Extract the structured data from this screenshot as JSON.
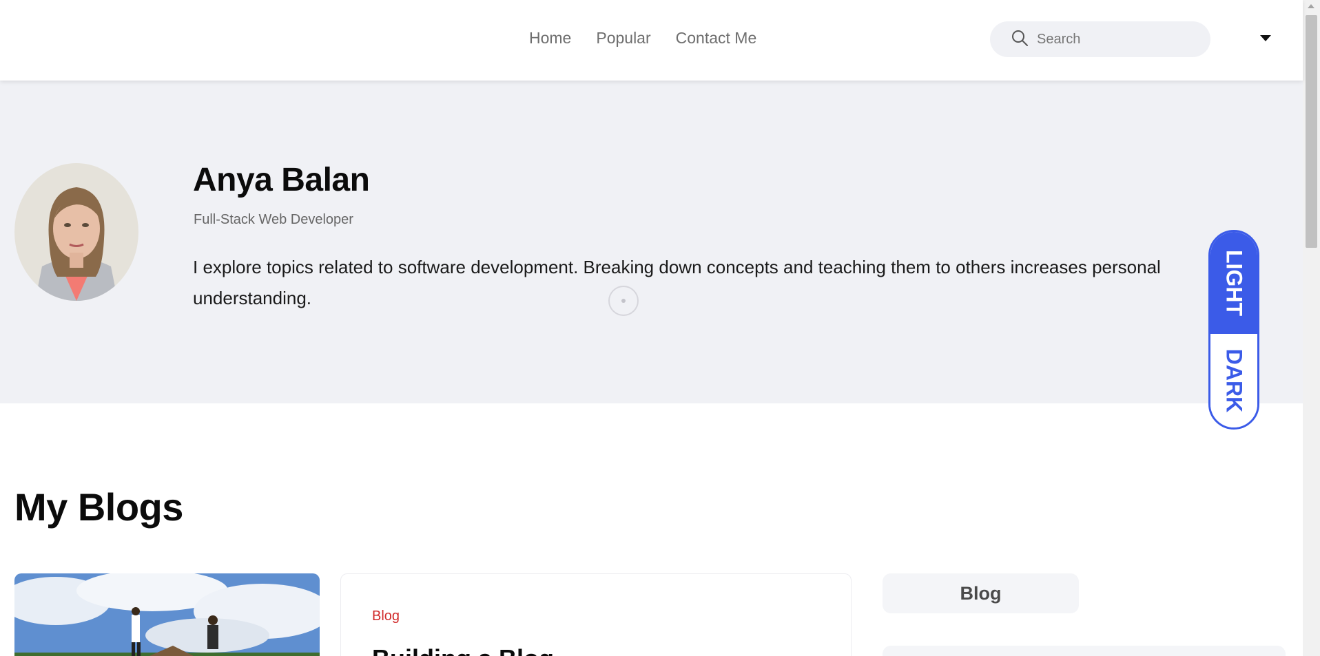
{
  "header": {
    "nav": [
      {
        "label": "Home"
      },
      {
        "label": "Popular"
      },
      {
        "label": "Contact Me"
      }
    ],
    "search": {
      "placeholder": "Search",
      "value": ""
    }
  },
  "profile": {
    "name": "Anya Balan",
    "role": "Full-Stack Web Developer",
    "bio": "I explore topics related to software development. Breaking down concepts and teaching them to others increases personal understanding."
  },
  "theme_toggle": {
    "light_label": "LIGHT",
    "dark_label": "DARK",
    "active": "light",
    "accent_color": "#3b5be8"
  },
  "blogs": {
    "section_title": "My Blogs",
    "featured_post": {
      "category": "Blog",
      "title": "Building a Blog",
      "category_color": "#d12a2a"
    },
    "sidebar": {
      "category_pill": "Blog"
    }
  }
}
